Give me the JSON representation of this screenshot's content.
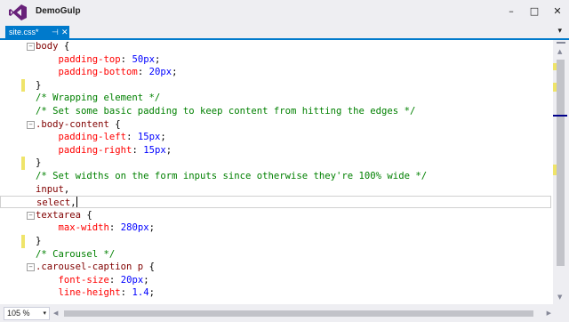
{
  "window": {
    "title": "DemoGulp",
    "minimize": "–",
    "maximize": "□",
    "close": "✕"
  },
  "tab": {
    "label": "site.css*",
    "pin": "⊣",
    "close": "✕",
    "dropdown": "▾"
  },
  "editor": {
    "lines": [
      {
        "fold": "−",
        "parts": [
          {
            "t": "body",
            "c": "sel"
          },
          {
            "t": " {",
            "c": "punc"
          }
        ]
      },
      {
        "parts": [
          {
            "t": "    padding-top",
            "c": "prop"
          },
          {
            "t": ": ",
            "c": "punc"
          },
          {
            "t": "50px",
            "c": "val"
          },
          {
            "t": ";",
            "c": "punc"
          }
        ]
      },
      {
        "parts": [
          {
            "t": "    padding-bottom",
            "c": "prop"
          },
          {
            "t": ": ",
            "c": "punc"
          },
          {
            "t": "20px",
            "c": "val"
          },
          {
            "t": ";",
            "c": "punc"
          }
        ]
      },
      {
        "parts": [
          {
            "t": "}",
            "c": "punc"
          }
        ]
      },
      {
        "parts": [
          {
            "t": "/* Wrapping element */",
            "c": "comment"
          }
        ]
      },
      {
        "parts": [
          {
            "t": "/* Set some basic padding to keep content from hitting the edges */",
            "c": "comment"
          }
        ]
      },
      {
        "fold": "−",
        "parts": [
          {
            "t": ".body-content",
            "c": "sel"
          },
          {
            "t": " {",
            "c": "punc"
          }
        ]
      },
      {
        "parts": [
          {
            "t": "    padding-left",
            "c": "prop"
          },
          {
            "t": ": ",
            "c": "punc"
          },
          {
            "t": "15px",
            "c": "val"
          },
          {
            "t": ";",
            "c": "punc"
          }
        ]
      },
      {
        "parts": [
          {
            "t": "    padding-right",
            "c": "prop"
          },
          {
            "t": ": ",
            "c": "punc"
          },
          {
            "t": "15px",
            "c": "val"
          },
          {
            "t": ";",
            "c": "punc"
          }
        ]
      },
      {
        "parts": [
          {
            "t": "}",
            "c": "punc"
          }
        ]
      },
      {
        "parts": [
          {
            "t": "/* Set widths on the form inputs since otherwise they're 100% wide */",
            "c": "comment"
          }
        ]
      },
      {
        "parts": [
          {
            "t": "input",
            "c": "sel"
          },
          {
            "t": ",",
            "c": "punc"
          }
        ]
      },
      {
        "current": true,
        "parts": [
          {
            "t": "select",
            "c": "sel"
          },
          {
            "t": ",",
            "c": "punc"
          }
        ]
      },
      {
        "fold": "−",
        "parts": [
          {
            "t": "textarea",
            "c": "sel"
          },
          {
            "t": " {",
            "c": "punc"
          }
        ]
      },
      {
        "parts": [
          {
            "t": "    max-width",
            "c": "prop"
          },
          {
            "t": ": ",
            "c": "punc"
          },
          {
            "t": "280px",
            "c": "val"
          },
          {
            "t": ";",
            "c": "punc"
          }
        ]
      },
      {
        "parts": [
          {
            "t": "}",
            "c": "punc"
          }
        ]
      },
      {
        "parts": [
          {
            "t": "/* Carousel */",
            "c": "comment"
          }
        ]
      },
      {
        "fold": "−",
        "parts": [
          {
            "t": ".carousel-caption p",
            "c": "sel"
          },
          {
            "t": " {",
            "c": "punc"
          }
        ]
      },
      {
        "parts": [
          {
            "t": "    font-size",
            "c": "prop"
          },
          {
            "t": ": ",
            "c": "punc"
          },
          {
            "t": "20px",
            "c": "val"
          },
          {
            "t": ";",
            "c": "punc"
          }
        ]
      },
      {
        "parts": [
          {
            "t": "    line-height",
            "c": "prop"
          },
          {
            "t": ": ",
            "c": "punc"
          },
          {
            "t": "1.4",
            "c": "val"
          },
          {
            "t": ";",
            "c": "punc"
          }
        ]
      }
    ],
    "changed_lines": [
      3,
      9,
      15
    ]
  },
  "status": {
    "zoom": "105 %",
    "zoom_caret": "▾"
  },
  "colors": {
    "accent": "#007acc",
    "selector": "#800000",
    "property": "#ff0000",
    "value": "#0000ff",
    "comment": "#008000",
    "change_mark": "#efe46a"
  }
}
